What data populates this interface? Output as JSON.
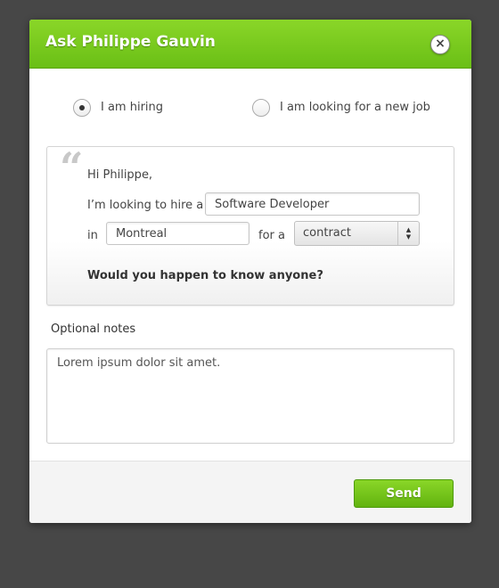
{
  "dialog": {
    "title": "Ask Philippe Gauvin",
    "close_icon": "close-icon",
    "close_glyph": "×"
  },
  "mode": {
    "options": [
      {
        "label": "I am hiring",
        "selected": true
      },
      {
        "label": "I am looking for a new job",
        "selected": false
      }
    ]
  },
  "message": {
    "quote_glyph": "“",
    "greeting": "Hi Philippe,",
    "hire_prefix": "I’m looking to hire a",
    "position_value": "Software Developer",
    "in_label": "in",
    "location_value": "Montreal",
    "for_label": "for a",
    "contract_type": "contract",
    "question": "Would you happen to know anyone?"
  },
  "notes": {
    "label": "Optional notes",
    "value": "Lorem ipsum dolor sit amet."
  },
  "footer": {
    "send_label": "Send"
  },
  "colors": {
    "accent": "#7acb1e",
    "background": "#474747"
  }
}
